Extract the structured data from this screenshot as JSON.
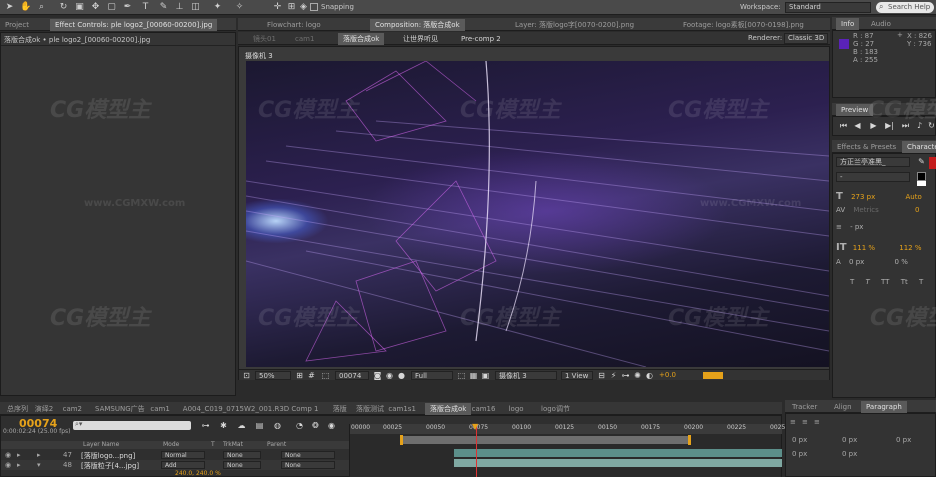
{
  "toolbar": {
    "snapping_label": "Snapping",
    "workspace_label": "Workspace:",
    "workspace_value": "Standard",
    "search_placeholder": "Search Help"
  },
  "left_panel": {
    "tab_project": "Project",
    "tab_effect_controls": "Effect Controls: ple logo2_[00060-00200].jpg",
    "subtitle": "落版合成ok • ple logo2_[00060-00200].jpg"
  },
  "viewer": {
    "tabs": [
      "Flowchart: logo",
      "Composition: 落版合成ok",
      "Layer: 落版logo字[0070-0200].png",
      "Footage: logo素板[0070-0198].png"
    ],
    "breadcrumbs": [
      "镜头01",
      "cam1",
      "落版合成ok",
      "让世界听见",
      "Pre-comp 2"
    ],
    "renderer_label": "Renderer:",
    "renderer_value": "Classic 3D",
    "camera_label": "摄像机 3",
    "zoom": "50%",
    "current_frame": "00074",
    "resolution": "Full",
    "camera_select": "摄像机 3",
    "view_select": "1 View",
    "exposure": "+0.0"
  },
  "info_panel": {
    "tab_info": "Info",
    "tab_audio": "Audio",
    "r": "R : 87",
    "g": "G : 27",
    "b": "B : 183",
    "a": "A : 255",
    "x": "X : 826",
    "y": "Y : 736",
    "swatch_color": "#5a22b8"
  },
  "preview_panel": {
    "title": "Preview"
  },
  "effects_tabs": {
    "effects": "Effects & Presets",
    "character": "Character"
  },
  "character_panel": {
    "font": "方正兰亭准黑_",
    "style": "-",
    "size": "273 px",
    "leading": "Auto",
    "kerning": "Metrics",
    "tracking": "0",
    "stroke": "- px",
    "vscale": "111 %",
    "hscale": "112 %",
    "baseline": "0 px",
    "tsume": "0 %",
    "text_buttons": [
      "T",
      "T",
      "TT",
      "Tt",
      "T",
      "T"
    ]
  },
  "timeline": {
    "tabs": [
      "总序列",
      "演绎2",
      "cam2",
      "SAMSUNG广告",
      "cam1",
      "A004_C019_0715W2_001.R3D Comp 1",
      "落版",
      "落版测试",
      "cam1s1",
      "落版合成ok",
      "cam16",
      "logo",
      "logo调节"
    ],
    "active_tab": "落版合成ok",
    "timecode": "00074",
    "timecode_sub": "0:00:02:24 (25.00 fps)",
    "columns": {
      "layer_name": "Layer Name",
      "mode": "Mode",
      "t": "T",
      "trkmat": "TrkMat",
      "parent": "Parent"
    },
    "ruler_labels": [
      "00000",
      "00025",
      "00050",
      "00075",
      "00100",
      "00125",
      "00150",
      "00175",
      "00200",
      "00225",
      "0025"
    ],
    "layers": [
      {
        "num": "47",
        "name": "[落版logo...png]",
        "mode": "Normal",
        "trkmat": "None",
        "parent": "None"
      },
      {
        "num": "48",
        "name": "[落版粒子[4...jpg]",
        "mode": "Add",
        "trkmat": "None",
        "parent": "None"
      }
    ],
    "sub_value": "240.0, 240.0 %"
  },
  "right_bottom": {
    "tabs": [
      "Tracker",
      "Align",
      "Paragraph"
    ],
    "rows": [
      [
        "0 px",
        "0 px",
        "0 px"
      ],
      [
        "0 px",
        "0 px",
        ""
      ]
    ]
  },
  "watermarks": {
    "logo": "CG模型主",
    "url": "www.CGMXW.com"
  }
}
